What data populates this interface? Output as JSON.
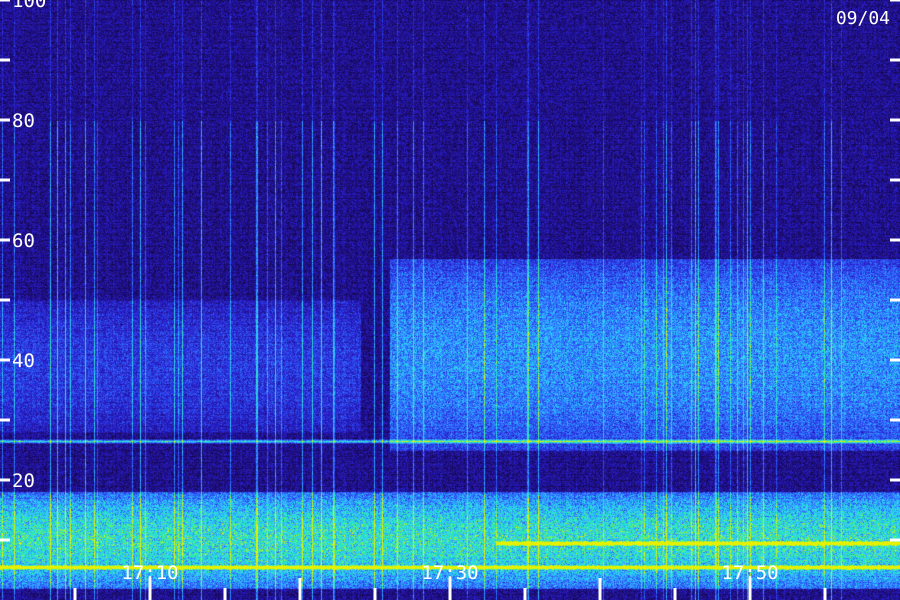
{
  "chart_data": {
    "type": "heatmap",
    "title": "",
    "date_label": "09/04",
    "xlabel": "",
    "ylabel": "",
    "x_start": "17:00",
    "x_end": "18:00",
    "x_tick_minutes_major": 10,
    "x_tick_minutes_minor": 5,
    "x_tick_labels": [
      "17:10",
      "17:30",
      "17:50"
    ],
    "y_range": [
      0,
      100
    ],
    "y_tick_step": 10,
    "y_tick_labels": [
      "20",
      "40",
      "60",
      "80",
      "100"
    ],
    "colormap": [
      "#0a0420",
      "#1a0a66",
      "#2a1fd0",
      "#2f6cff",
      "#2fd0ff",
      "#28f0a0",
      "#e8f000"
    ],
    "features": [
      {
        "name": "constant-line",
        "y": 26.5,
        "x_from": "17:00",
        "x_to": "18:00",
        "intensity": 0.55
      },
      {
        "name": "low-band",
        "y_from": 2,
        "y_to": 18,
        "x_from": "17:00",
        "x_to": "18:00",
        "intensity": 0.7
      },
      {
        "name": "bright-line",
        "y": 5.5,
        "x_from": "17:00",
        "x_to": "18:00",
        "intensity": 0.95
      },
      {
        "name": "bright-line",
        "y": 9.5,
        "x_from": "17:33",
        "x_to": "18:00",
        "intensity": 0.9
      },
      {
        "name": "hiss-band",
        "y_from": 25,
        "y_to": 57,
        "x_from": "17:26",
        "x_to": "18:00",
        "intensity": 0.45
      },
      {
        "name": "hiss-band",
        "y_from": 28,
        "y_to": 50,
        "x_from": "17:00",
        "x_to": "17:24",
        "intensity": 0.22
      }
    ]
  }
}
